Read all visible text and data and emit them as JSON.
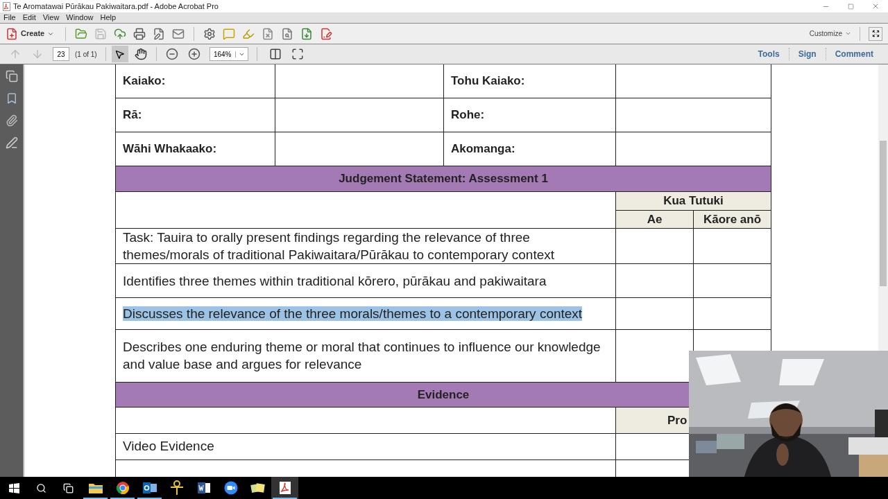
{
  "window": {
    "title": "Te Aromatawai Pūrākau Pakiwaitara.pdf - Adobe Acrobat Pro"
  },
  "menu": [
    "File",
    "Edit",
    "View",
    "Window",
    "Help"
  ],
  "toolbar": {
    "create": "Create",
    "customize": "Customize"
  },
  "navigation": {
    "page": "23",
    "page_count": "(1 of 1)",
    "zoom": "164%"
  },
  "panes": [
    "Tools",
    "Sign",
    "Comment"
  ],
  "document": {
    "info_rows": [
      [
        "Kaiako:",
        "Tohu Kaiako:"
      ],
      [
        "Rā:",
        "Rohe:"
      ],
      [
        "Wāhi Whakaako:",
        "Akomanga:"
      ]
    ],
    "judgement_header": "Judgement Statement:  Assessment 1",
    "achieved_header": "Kua Tutuki",
    "achieved_columns": [
      "Ae",
      "Kāore anō"
    ],
    "criteria": [
      {
        "text": "Task:  Tauira to orally present findings regarding the relevance of three themes/morals of traditional Pakiwaitara/Pūrākau to contemporary context",
        "highlighted": false
      },
      {
        "text": "Identifies three themes within traditional kōrero, pūrākau and pakiwaitara",
        "highlighted": false
      },
      {
        "text": "Discusses the relevance of the three morals/themes to a contemporary context",
        "highlighted": true
      },
      {
        "text": "Describes one enduring theme or moral that continues to influence our knowledge and value base and argues for relevance",
        "highlighted": false
      }
    ],
    "evidence_header": "Evidence",
    "evidence_column": "Pro",
    "evidence_rows": [
      "Video Evidence"
    ]
  },
  "webcam": {
    "kind": "picture"
  },
  "taskbar": [
    {
      "kind": "explorer",
      "running": true,
      "selected": false
    },
    {
      "kind": "chrome",
      "running": true,
      "selected": false
    },
    {
      "kind": "outlook",
      "running": true,
      "selected": false
    },
    {
      "kind": "key",
      "running": false,
      "selected": false
    },
    {
      "kind": "word",
      "running": false,
      "selected": false
    },
    {
      "kind": "zoom",
      "running": false,
      "selected": false
    },
    {
      "kind": "notes",
      "running": false,
      "selected": false
    },
    {
      "kind": "acrobat",
      "running": true,
      "selected": true
    }
  ]
}
